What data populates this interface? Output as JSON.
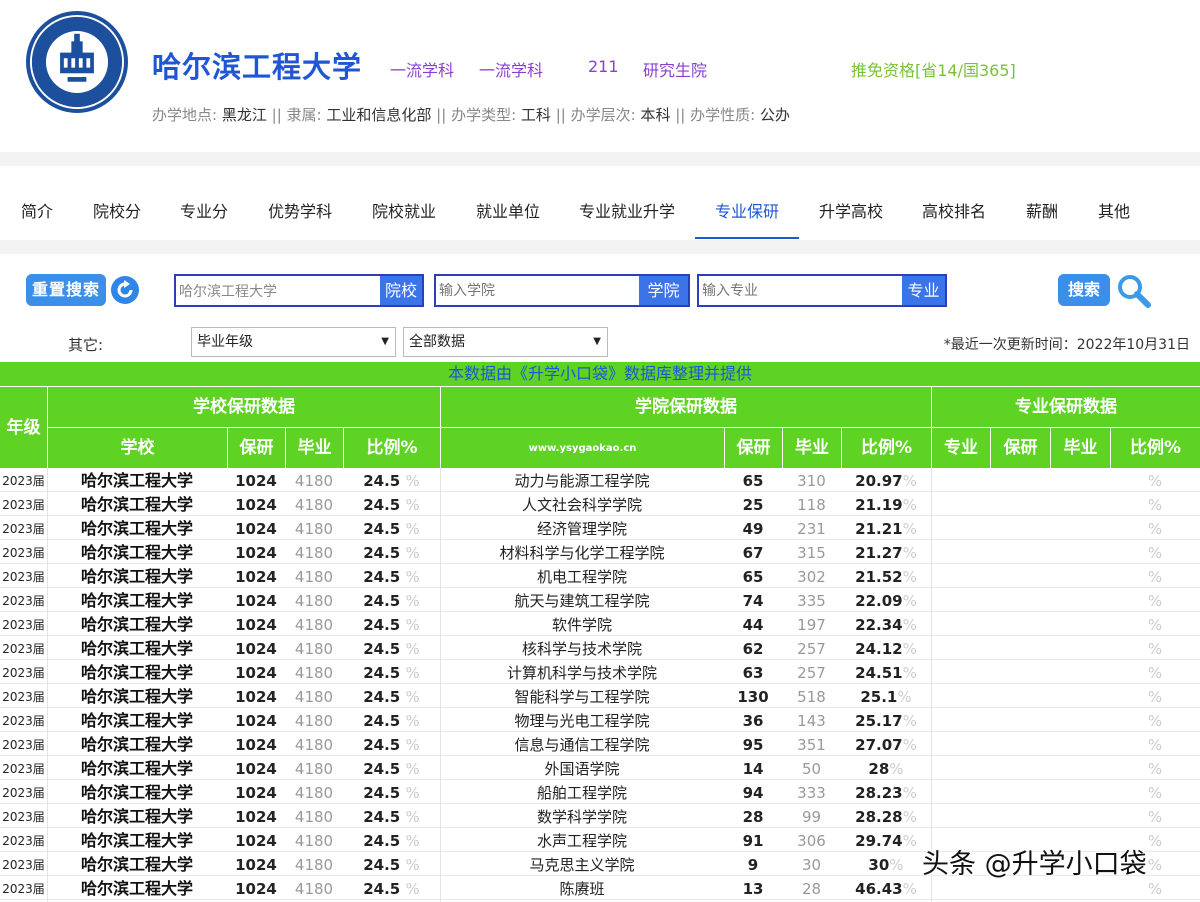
{
  "header": {
    "uni_name": "哈尔滨工程大学",
    "tags": [
      "一流学科",
      "一流学科",
      "211",
      "研究生院"
    ],
    "tuimian": "推免资格[省14/国365]",
    "info": [
      {
        "label": "办学地点:",
        "value": "黑龙江"
      },
      {
        "label": "隶属:",
        "value": "工业和信息化部"
      },
      {
        "label": "办学类型:",
        "value": "工科"
      },
      {
        "label": "办学层次:",
        "value": "本科"
      },
      {
        "label": "办学性质:",
        "value": "公办"
      }
    ],
    "separator": "||"
  },
  "nav": {
    "items": [
      "简介",
      "院校分",
      "专业分",
      "优势学科",
      "院校就业",
      "就业单位",
      "专业就业升学",
      "专业保研",
      "升学高校",
      "高校排名",
      "薪酬",
      "其他"
    ],
    "active": "专业保研"
  },
  "search": {
    "reset_label": "重置搜索",
    "school_value": "哈尔滨工程大学",
    "school_tag": "院校",
    "college_placeholder": "输入学院",
    "college_tag": "学院",
    "major_placeholder": "输入专业",
    "major_tag": "专业",
    "search_label": "搜索"
  },
  "filters": {
    "other_label": "其它:",
    "grade_select": "毕业年级",
    "data_select": "全部数据",
    "update_time": "*最近一次更新时间：2022年10月31日"
  },
  "table": {
    "banner": "本数据由《升学小口袋》数据库整理并提供",
    "year_header": "年级",
    "group_school": "学校保研数据",
    "group_college": "学院保研数据",
    "group_major": "专业保研数据",
    "school_cols": [
      "学校",
      "保研",
      "毕业",
      "比例%"
    ],
    "college_cols": [
      "www.ysygaokao.cn",
      "保研",
      "毕业",
      "比例%"
    ],
    "major_cols": [
      "专业",
      "保研",
      "毕业",
      "比例%"
    ],
    "pct_sign": "%",
    "rows": [
      {
        "year": "2023届",
        "school": "哈尔滨工程大学",
        "by": "1024",
        "grad": "4180",
        "ratio": "24.5",
        "college": "动力与能源工程学院",
        "cby": "65",
        "cgrad": "310",
        "cratio": "20.97"
      },
      {
        "year": "2023届",
        "school": "哈尔滨工程大学",
        "by": "1024",
        "grad": "4180",
        "ratio": "24.5",
        "college": "人文社会科学学院",
        "cby": "25",
        "cgrad": "118",
        "cratio": "21.19"
      },
      {
        "year": "2023届",
        "school": "哈尔滨工程大学",
        "by": "1024",
        "grad": "4180",
        "ratio": "24.5",
        "college": "经济管理学院",
        "cby": "49",
        "cgrad": "231",
        "cratio": "21.21"
      },
      {
        "year": "2023届",
        "school": "哈尔滨工程大学",
        "by": "1024",
        "grad": "4180",
        "ratio": "24.5",
        "college": "材料科学与化学工程学院",
        "cby": "67",
        "cgrad": "315",
        "cratio": "21.27"
      },
      {
        "year": "2023届",
        "school": "哈尔滨工程大学",
        "by": "1024",
        "grad": "4180",
        "ratio": "24.5",
        "college": "机电工程学院",
        "cby": "65",
        "cgrad": "302",
        "cratio": "21.52"
      },
      {
        "year": "2023届",
        "school": "哈尔滨工程大学",
        "by": "1024",
        "grad": "4180",
        "ratio": "24.5",
        "college": "航天与建筑工程学院",
        "cby": "74",
        "cgrad": "335",
        "cratio": "22.09"
      },
      {
        "year": "2023届",
        "school": "哈尔滨工程大学",
        "by": "1024",
        "grad": "4180",
        "ratio": "24.5",
        "college": "软件学院",
        "cby": "44",
        "cgrad": "197",
        "cratio": "22.34"
      },
      {
        "year": "2023届",
        "school": "哈尔滨工程大学",
        "by": "1024",
        "grad": "4180",
        "ratio": "24.5",
        "college": "核科学与技术学院",
        "cby": "62",
        "cgrad": "257",
        "cratio": "24.12"
      },
      {
        "year": "2023届",
        "school": "哈尔滨工程大学",
        "by": "1024",
        "grad": "4180",
        "ratio": "24.5",
        "college": "计算机科学与技术学院",
        "cby": "63",
        "cgrad": "257",
        "cratio": "24.51"
      },
      {
        "year": "2023届",
        "school": "哈尔滨工程大学",
        "by": "1024",
        "grad": "4180",
        "ratio": "24.5",
        "college": "智能科学与工程学院",
        "cby": "130",
        "cgrad": "518",
        "cratio": "25.1"
      },
      {
        "year": "2023届",
        "school": "哈尔滨工程大学",
        "by": "1024",
        "grad": "4180",
        "ratio": "24.5",
        "college": "物理与光电工程学院",
        "cby": "36",
        "cgrad": "143",
        "cratio": "25.17"
      },
      {
        "year": "2023届",
        "school": "哈尔滨工程大学",
        "by": "1024",
        "grad": "4180",
        "ratio": "24.5",
        "college": "信息与通信工程学院",
        "cby": "95",
        "cgrad": "351",
        "cratio": "27.07"
      },
      {
        "year": "2023届",
        "school": "哈尔滨工程大学",
        "by": "1024",
        "grad": "4180",
        "ratio": "24.5",
        "college": "外国语学院",
        "cby": "14",
        "cgrad": "50",
        "cratio": "28"
      },
      {
        "year": "2023届",
        "school": "哈尔滨工程大学",
        "by": "1024",
        "grad": "4180",
        "ratio": "24.5",
        "college": "船舶工程学院",
        "cby": "94",
        "cgrad": "333",
        "cratio": "28.23"
      },
      {
        "year": "2023届",
        "school": "哈尔滨工程大学",
        "by": "1024",
        "grad": "4180",
        "ratio": "24.5",
        "college": "数学科学学院",
        "cby": "28",
        "cgrad": "99",
        "cratio": "28.28"
      },
      {
        "year": "2023届",
        "school": "哈尔滨工程大学",
        "by": "1024",
        "grad": "4180",
        "ratio": "24.5",
        "college": "水声工程学院",
        "cby": "91",
        "cgrad": "306",
        "cratio": "29.74"
      },
      {
        "year": "2023届",
        "school": "哈尔滨工程大学",
        "by": "1024",
        "grad": "4180",
        "ratio": "24.5",
        "college": "马克思主义学院",
        "cby": "9",
        "cgrad": "30",
        "cratio": "30"
      },
      {
        "year": "2023届",
        "school": "哈尔滨工程大学",
        "by": "1024",
        "grad": "4180",
        "ratio": "24.5",
        "college": "陈赓班",
        "cby": "13",
        "cgrad": "28",
        "cratio": "46.43"
      }
    ]
  },
  "watermark": "头条 @升学小口袋",
  "colors": {
    "brand_blue": "#1f56d6",
    "table_green": "#5fd324",
    "tag_purple": "#8a3fcf",
    "tuimian_green": "#7ac13a"
  }
}
